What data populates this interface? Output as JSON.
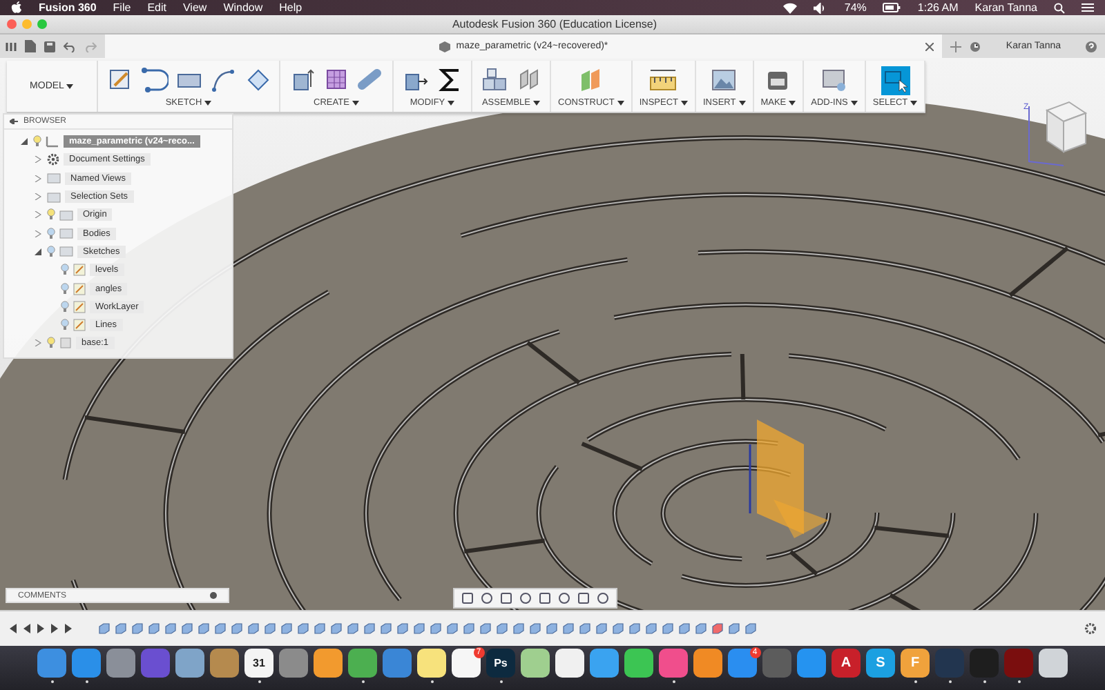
{
  "menubar": {
    "app_name": "Fusion 360",
    "menus": [
      "File",
      "Edit",
      "View",
      "Window",
      "Help"
    ],
    "battery": "74%",
    "time": "1:26 AM",
    "user": "Karan Tanna"
  },
  "window": {
    "title": "Autodesk Fusion 360 (Education License)"
  },
  "document_tab": {
    "title": "maze_parametric (v24~recovered)*",
    "user": "Karan Tanna"
  },
  "toolbar": {
    "workspace": "MODEL",
    "groups": [
      {
        "label": "SKETCH",
        "selected": false
      },
      {
        "label": "CREATE",
        "selected": false
      },
      {
        "label": "MODIFY",
        "selected": false
      },
      {
        "label": "ASSEMBLE",
        "selected": false
      },
      {
        "label": "CONSTRUCT",
        "selected": false
      },
      {
        "label": "INSPECT",
        "selected": false
      },
      {
        "label": "INSERT",
        "selected": false
      },
      {
        "label": "MAKE",
        "selected": false
      },
      {
        "label": "ADD-INS",
        "selected": false
      },
      {
        "label": "SELECT",
        "selected": true
      }
    ]
  },
  "browser": {
    "title": "BROWSER",
    "root": {
      "label": "maze_parametric (v24~reco...",
      "kind": "component",
      "visible": true,
      "expanded": true,
      "selected": true,
      "children": [
        {
          "label": "Document Settings",
          "kind": "gear",
          "expanded": false,
          "selected": false
        },
        {
          "label": "Named Views",
          "kind": "folder",
          "expanded": false,
          "selected": false
        },
        {
          "label": "Selection Sets",
          "kind": "folder",
          "expanded": false,
          "selected": false
        },
        {
          "label": "Origin",
          "kind": "folder",
          "visible": true,
          "expanded": false,
          "selected": false
        },
        {
          "label": "Bodies",
          "kind": "folder",
          "visible": false,
          "expanded": false,
          "selected": false
        },
        {
          "label": "Sketches",
          "kind": "folder",
          "visible": false,
          "expanded": true,
          "selected": false,
          "children": [
            {
              "label": "levels",
              "kind": "sketch",
              "visible": false,
              "selected": false
            },
            {
              "label": "angles",
              "kind": "sketch",
              "visible": false,
              "selected": false
            },
            {
              "label": "WorkLayer",
              "kind": "sketch",
              "visible": false,
              "selected": false
            },
            {
              "label": "Lines",
              "kind": "sketch",
              "visible": false,
              "selected": false
            }
          ]
        },
        {
          "label": "base:1",
          "kind": "body",
          "visible": true,
          "expanded": false,
          "selected": false
        }
      ]
    }
  },
  "view_cube": {
    "axis": "Z"
  },
  "comments": {
    "title": "COMMENTS"
  },
  "dock": [
    {
      "kind": "finder",
      "color": "#3d8fe0",
      "running": true
    },
    {
      "kind": "safari",
      "color": "#2a8fe8",
      "running": true
    },
    {
      "kind": "rocket",
      "color": "#8a8f99",
      "running": false
    },
    {
      "kind": "siri",
      "color": "#6a4fd0",
      "running": false
    },
    {
      "kind": "bird",
      "color": "#7fa4c8",
      "running": false
    },
    {
      "kind": "book",
      "color": "#b58a4e",
      "running": false
    },
    {
      "kind": "calendar",
      "color": "#f4f4f4",
      "glyph": "31",
      "running": true
    },
    {
      "kind": "photo",
      "color": "#8b8b8b",
      "running": false
    },
    {
      "kind": "document",
      "color": "#f29a2e",
      "running": false
    },
    {
      "kind": "chrome",
      "color": "#4caf50",
      "running": true
    },
    {
      "kind": "podium",
      "color": "#3a86d6",
      "running": false
    },
    {
      "kind": "notepad",
      "color": "#f7e27c",
      "running": true
    },
    {
      "kind": "list",
      "color": "#f6f6f6",
      "badge": "7",
      "running": false
    },
    {
      "kind": "photoshop",
      "color": "#0d2a3f",
      "glyph": "Ps",
      "running": true
    },
    {
      "kind": "map",
      "color": "#9fcf8f",
      "running": false
    },
    {
      "kind": "flower",
      "color": "#f0f0f0",
      "running": false
    },
    {
      "kind": "speech",
      "color": "#3aa3f0",
      "running": false
    },
    {
      "kind": "camera",
      "color": "#3cc553",
      "running": false
    },
    {
      "kind": "note",
      "color": "#f04e8c",
      "running": true
    },
    {
      "kind": "openbook",
      "color": "#f08a24",
      "running": false
    },
    {
      "kind": "appstore",
      "color": "#2a8ef0",
      "badge": "4",
      "running": false
    },
    {
      "kind": "horse",
      "color": "#5c5c5c",
      "running": false
    },
    {
      "kind": "share",
      "color": "#2593f0",
      "running": false
    },
    {
      "kind": "autocad",
      "color": "#c8202a",
      "glyph": "A",
      "running": false
    },
    {
      "kind": "skype",
      "color": "#1ba0e1",
      "glyph": "S",
      "running": false
    },
    {
      "kind": "fusion",
      "color": "#f0a23c",
      "glyph": "F",
      "running": true
    },
    {
      "kind": "code",
      "color": "#22354f",
      "running": true
    },
    {
      "kind": "terminal",
      "color": "#1e1e1e",
      "running": true
    },
    {
      "kind": "acrobat",
      "color": "#7a0e0e",
      "running": true
    },
    {
      "kind": "trash",
      "color": "#d0d4d8",
      "running": false
    }
  ]
}
